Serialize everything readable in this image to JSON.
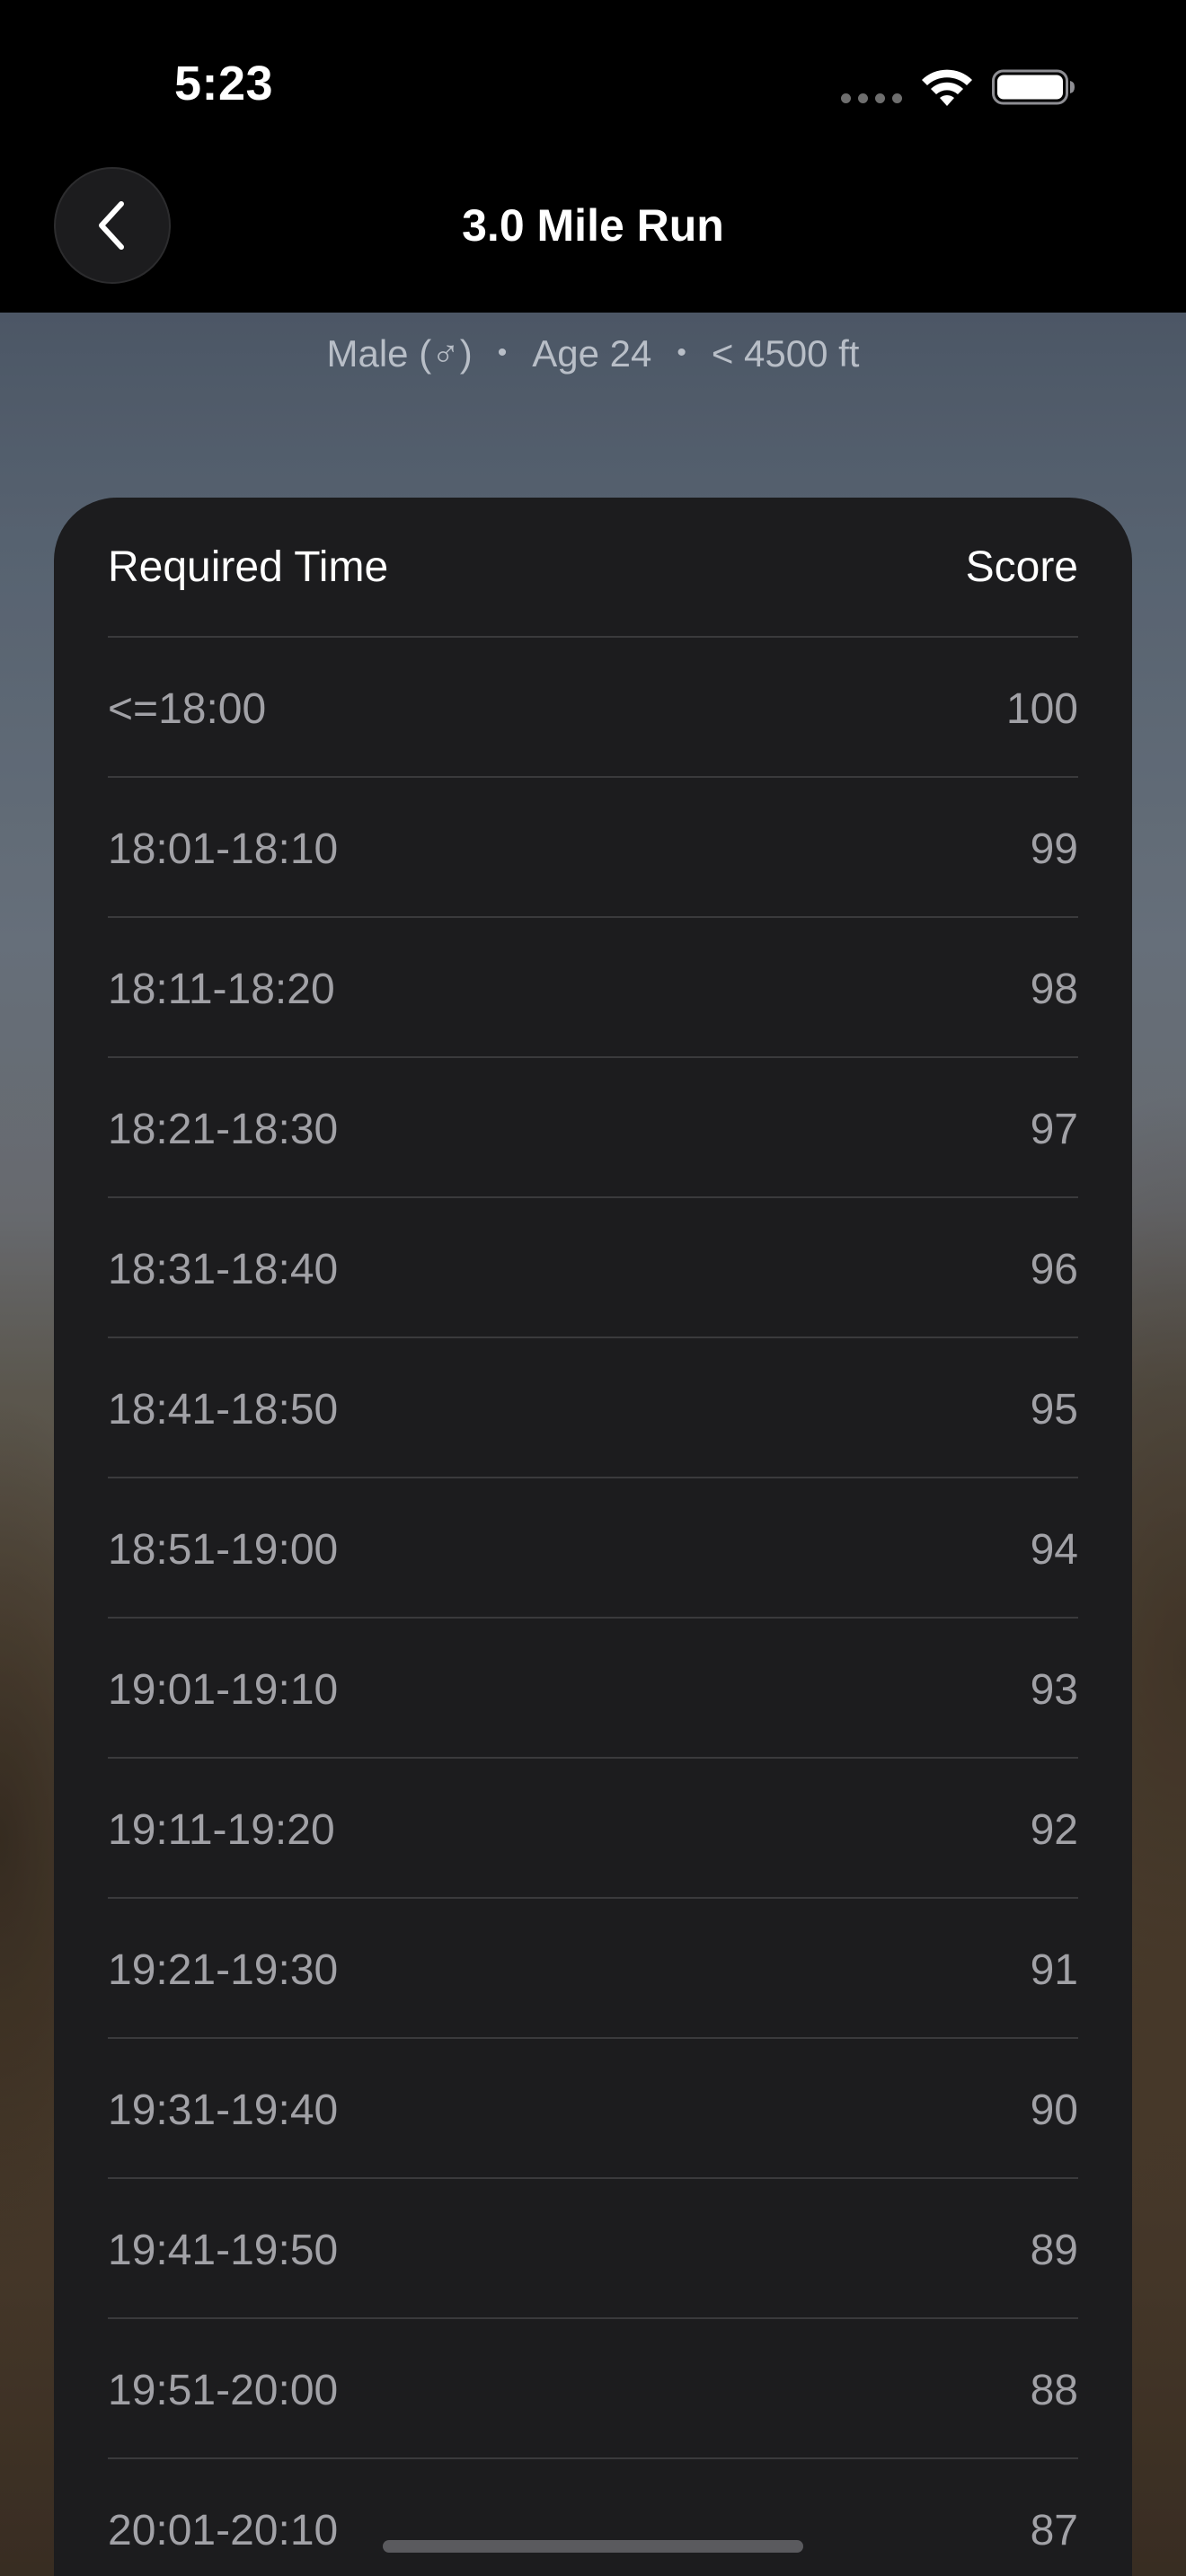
{
  "status_bar": {
    "time": "5:23",
    "icons": [
      "signal-dots-icon",
      "wifi-icon",
      "battery-icon"
    ]
  },
  "nav": {
    "back_icon": "chevron-left-icon",
    "title": "3.0 Mile Run"
  },
  "filters": {
    "sex": "Male (♂)",
    "age": "Age 24",
    "altitude": "< 4500 ft",
    "separator": "•"
  },
  "table": {
    "headers": {
      "time": "Required Time",
      "score": "Score"
    },
    "rows": [
      {
        "time": "<=18:00",
        "score": "100"
      },
      {
        "time": "18:01-18:10",
        "score": "99"
      },
      {
        "time": "18:11-18:20",
        "score": "98"
      },
      {
        "time": "18:21-18:30",
        "score": "97"
      },
      {
        "time": "18:31-18:40",
        "score": "96"
      },
      {
        "time": "18:41-18:50",
        "score": "95"
      },
      {
        "time": "18:51-19:00",
        "score": "94"
      },
      {
        "time": "19:01-19:10",
        "score": "93"
      },
      {
        "time": "19:11-19:20",
        "score": "92"
      },
      {
        "time": "19:21-19:30",
        "score": "91"
      },
      {
        "time": "19:31-19:40",
        "score": "90"
      },
      {
        "time": "19:41-19:50",
        "score": "89"
      },
      {
        "time": "19:51-20:00",
        "score": "88"
      },
      {
        "time": "20:01-20:10",
        "score": "87"
      }
    ]
  },
  "colors": {
    "background": "#000000",
    "card": "#1c1c1e",
    "divider": "#3a3a3c",
    "primary_text": "#ffffff",
    "secondary_text": "#a1a1a6"
  }
}
